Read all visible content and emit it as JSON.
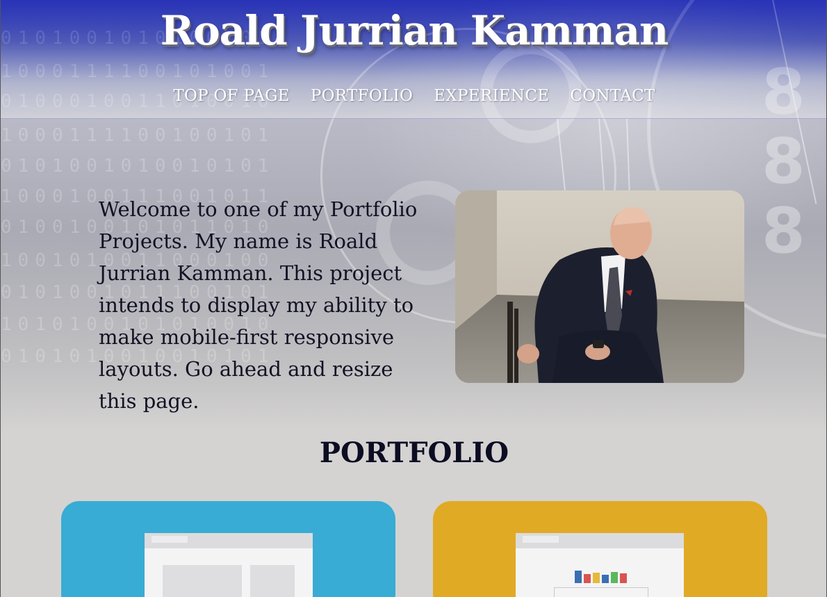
{
  "site": {
    "title": "Roald Jurrian Kamman"
  },
  "nav": {
    "items": [
      {
        "label": "TOP OF PAGE"
      },
      {
        "label": "PORTFOLIO"
      },
      {
        "label": "EXPERIENCE"
      },
      {
        "label": "CONTACT"
      }
    ]
  },
  "intro": {
    "text": "Welcome to one of my Portfolio Projects. My name is Roald Jurrian Kamman. This project intends to display my ability to make mobile-first responsive layouts. Go ahead and resize this page."
  },
  "portfolio": {
    "heading": "PORTFOLIO",
    "cards": [
      {
        "color": "#38acd4",
        "icon": "webpage-layout-icon"
      },
      {
        "color": "#e0aa25",
        "icon": "webpage-chart-icon"
      }
    ]
  },
  "colors": {
    "header_blue": "#2a35b0",
    "page_background": "#d4d3d2",
    "text_dark": "#121224"
  },
  "binary_rows": [
    "0101001010100101",
    "1000111100101001",
    "0100010011010010",
    "1000111100100101",
    "0101001010010101",
    "1000100111001011",
    "0100100101011010",
    "1001010011000100",
    "0101001011100101",
    "1010100101010010",
    "0101010010010101"
  ]
}
